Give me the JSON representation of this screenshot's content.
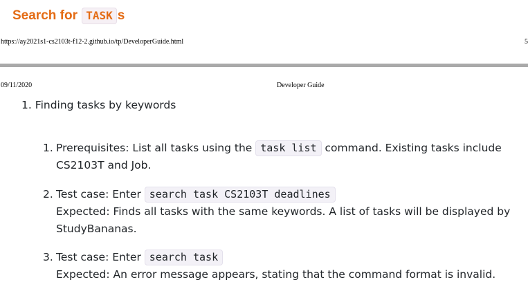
{
  "heading": {
    "prefix": "Search for ",
    "code": "TASK",
    "suffix": "s"
  },
  "print_footer": {
    "url": "https://ay2021s1-cs2103t-f12-2.github.io/tp/DeveloperGuide.html",
    "page_number": "5"
  },
  "print_header": {
    "date": "09/11/2020",
    "title": "Developer Guide"
  },
  "section": {
    "number": "1.",
    "title": "Finding tasks by keywords"
  },
  "steps": [
    {
      "number": "1.",
      "text_before": "Prerequisites: List all tasks using the ",
      "code": "task list",
      "text_after": " command. Existing tasks include",
      "line2": "CS2103T and Job."
    },
    {
      "number": "2.",
      "text_before": "Test case: Enter ",
      "code": "search task CS2103T deadlines",
      "expected_line1": "Expected: Finds all tasks with the same keywords. A list of tasks will be displayed by",
      "expected_line2": "StudyBananas."
    },
    {
      "number": "3.",
      "text_before": "Test case: Enter ",
      "code": "search task",
      "expected_line1": "Expected: An error message appears, stating that the command format is invalid."
    }
  ]
}
